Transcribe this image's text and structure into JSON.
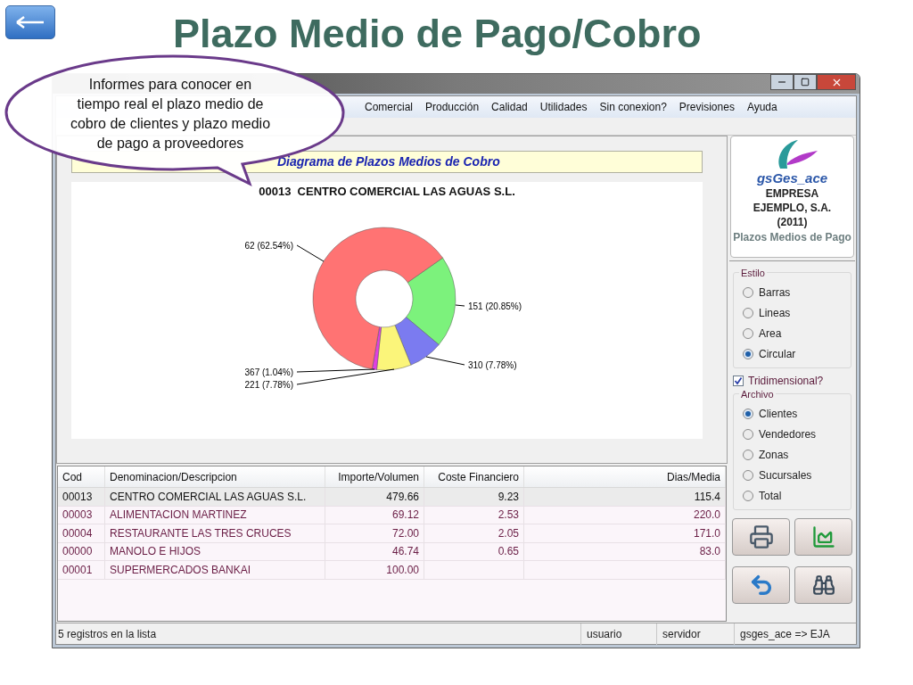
{
  "slide": {
    "title": "Plazo Medio de Pago/Cobro",
    "callout": "Informes para conocer en tiempo real el plazo medio de cobro de clientes y plazo medio de pago a proveedores"
  },
  "menu": [
    "Comercial",
    "Producción",
    "Calidad",
    "Utilidades",
    "Sin conexion?",
    "Previsiones",
    "Ayuda"
  ],
  "chart_panel": {
    "header": "Diagrama de Plazos Medios de Cobro",
    "title": "00013  CENTRO COMERCIAL LAS AGUAS S.L.",
    "chart_data": {
      "type": "donut",
      "categories": [
        "151 (20.85%)",
        "310 (7.78%)",
        "221 (7.78%)",
        "367 (1.04%)",
        "62 (62.54%)"
      ],
      "series": [
        {
          "values": [
            20.85,
            7.78,
            7.78,
            1.04,
            62.54
          ],
          "colors": [
            "#7cf27c",
            "#7b7bf0",
            "#fbf57a",
            "#e040e0",
            "#ff7373"
          ]
        }
      ]
    }
  },
  "table": {
    "columns": [
      "Cod",
      "Denominacion/Descripcion",
      "Importe/Volumen",
      "Coste Financiero",
      "Dias/Media"
    ],
    "rows": [
      {
        "cells": [
          "00013",
          "CENTRO COMERCIAL LAS AGUAS S.L.",
          "479.66",
          "9.23",
          "115.4"
        ],
        "selected": true
      },
      {
        "cells": [
          "00003",
          "ALIMENTACION MARTINEZ",
          "69.12",
          "2.53",
          "220.0"
        ],
        "selected": false
      },
      {
        "cells": [
          "00004",
          "RESTAURANTE LAS TRES CRUCES",
          "72.00",
          "2.05",
          "171.0"
        ],
        "selected": false
      },
      {
        "cells": [
          "00000",
          "MANOLO E HIJOS",
          "46.74",
          "0.65",
          "83.0"
        ],
        "selected": false
      },
      {
        "cells": [
          "00001",
          "SUPERMERCADOS BANKAI",
          "100.00",
          null,
          null
        ],
        "selected": false
      }
    ]
  },
  "sidebar": {
    "brand": "gsGes_ace",
    "company": [
      "EMPRESA",
      "EJEMPLO, S.A.",
      "(2011)"
    ],
    "module": "Plazos Medios de Pago",
    "estilo": {
      "label": "Estilo",
      "options": [
        {
          "label": "Barras",
          "selected": false
        },
        {
          "label": "Lineas",
          "selected": false
        },
        {
          "label": "Area",
          "selected": false
        },
        {
          "label": "Circular",
          "selected": true
        }
      ]
    },
    "tridimensional": {
      "label": "Tridimensional?",
      "checked": true
    },
    "archivo": {
      "label": "Archivo",
      "options": [
        {
          "label": "Clientes",
          "selected": true
        },
        {
          "label": "Vendedores",
          "selected": false
        },
        {
          "label": "Zonas",
          "selected": false
        },
        {
          "label": "Sucursales",
          "selected": false
        },
        {
          "label": "Total",
          "selected": false
        }
      ]
    }
  },
  "status_bar": [
    "5 registros en la lista",
    "usuario",
    "servidor",
    "gsges_ace => EJA"
  ]
}
